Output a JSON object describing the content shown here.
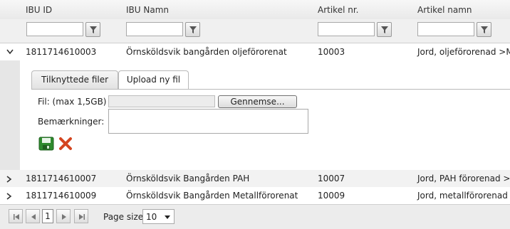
{
  "columns": {
    "ibu_id": "IBU ID",
    "ibu_namn": "IBU Namn",
    "artikel_nr": "Artikel nr.",
    "artikel_namn": "Artikel namn"
  },
  "rows": [
    {
      "id": "1811714610003",
      "namn": "Örnsköldsvik bangården oljeförorenat",
      "artikel_nr": "10003",
      "artikel_namn": "Jord, oljeförorenad >MKI",
      "expanded": true
    },
    {
      "id": "1811714610007",
      "namn": "Örnsköldsvik Bangården PAH",
      "artikel_nr": "10007",
      "artikel_namn": "Jord, PAH förorenad >M",
      "expanded": false
    },
    {
      "id": "1811714610009",
      "namn": "Örnsköldsvik Bangården Metallförorenat",
      "artikel_nr": "10009",
      "artikel_namn": "Jord, metallförorenad >M",
      "expanded": false
    }
  ],
  "detail": {
    "tabs": [
      "Tilknyttede filer",
      "Upload ny fil"
    ],
    "active_tab": "Upload ny fil",
    "file_label": "Fil: (max 1,5GB)",
    "browse_label": "Gennemse...",
    "notes_label": "Bemærkninger:"
  },
  "pager": {
    "current_page": "1",
    "page_size_label": "Page size:",
    "page_size_value": "10"
  }
}
